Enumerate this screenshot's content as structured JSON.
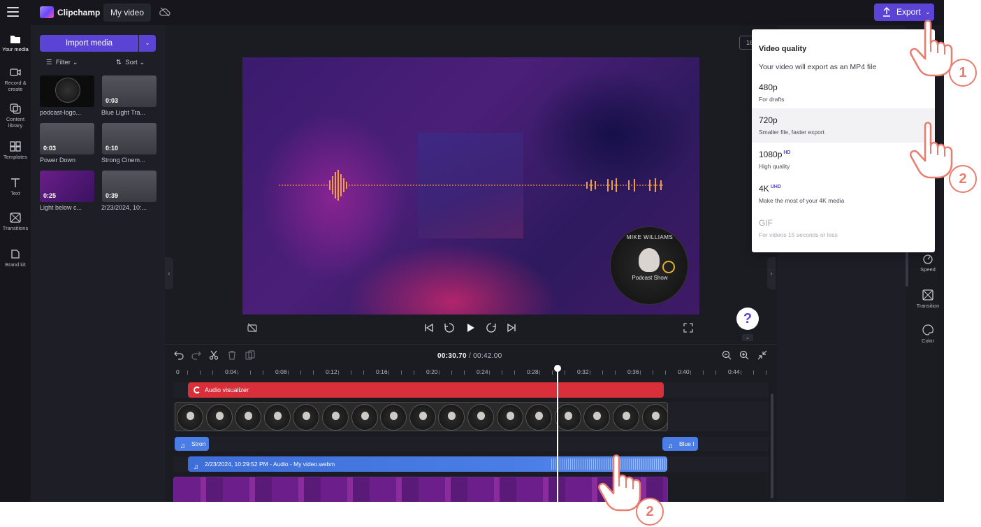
{
  "app": {
    "name": "Clipchamp",
    "project_title": "My video",
    "brand_color": "#5b43d6"
  },
  "toolbar": {
    "export_label": "Export",
    "menu_icon": "hamburger-icon",
    "cloud_icon": "cloud-off-icon"
  },
  "rail": {
    "items": [
      {
        "label": "Your media",
        "icon": "folder-icon"
      },
      {
        "label": "Record & create",
        "icon": "camera-icon"
      },
      {
        "label": "Content library",
        "icon": "library-icon"
      },
      {
        "label": "Templates",
        "icon": "templates-icon"
      },
      {
        "label": "Text",
        "icon": "text-icon"
      },
      {
        "label": "Transitions",
        "icon": "transitions-icon"
      },
      {
        "label": "Brand kit",
        "icon": "brand-kit-icon"
      }
    ]
  },
  "media": {
    "import_label": "Import media",
    "filter_label": "Filter",
    "sort_label": "Sort",
    "items": [
      {
        "caption": "podcast-logo...",
        "duration": ""
      },
      {
        "caption": "Blue Light Tra...",
        "duration": "0:03"
      },
      {
        "caption": "Power Down",
        "duration": "0:03"
      },
      {
        "caption": "Strong Cinem...",
        "duration": "0:10"
      },
      {
        "caption": "Light below c...",
        "duration": "0:25"
      },
      {
        "caption": "2/23/2024, 10:...",
        "duration": "0:39"
      }
    ]
  },
  "preview": {
    "aspect_label": "16",
    "podcast_name": "MIKE WILLIAMS",
    "podcast_show": "Podcast Show",
    "help_label": "?"
  },
  "properties": {
    "items": [
      {
        "label": "Speed",
        "icon": "speed-icon"
      },
      {
        "label": "Transition",
        "icon": "transition-icon"
      },
      {
        "label": "Color",
        "icon": "color-palette-icon"
      }
    ]
  },
  "timeline": {
    "current_time": "00:30.70",
    "total_time": "/ 00:42.00",
    "ticks": [
      "0",
      "0:04",
      "0:08",
      "0:12",
      "0:16",
      "0:20",
      "0:24",
      "0:28",
      "0:32",
      "0:36",
      "0:40",
      "0:44"
    ],
    "clips": {
      "visualizer": "Audio visualizer",
      "music_left": "Stron",
      "music_right": "Blue l",
      "audio": "2/23/2024, 10:29:52 PM - Audio - My video.webm"
    }
  },
  "export_menu": {
    "title": "Video quality",
    "subtitle": "Your video will export as an MP4 file",
    "options": [
      {
        "title": "480p",
        "badge": "",
        "desc": "For drafts"
      },
      {
        "title": "720p",
        "badge": "",
        "desc": "Smaller file, faster export"
      },
      {
        "title": "1080p",
        "badge": "HD",
        "desc": "High quality"
      },
      {
        "title": "4K",
        "badge": "UHD",
        "desc": "Make the most of your 4K media"
      },
      {
        "title": "GIF",
        "badge": "",
        "desc": "For videos 15 seconds or less"
      }
    ]
  },
  "annotations": {
    "step_export": "1",
    "step_720p": "2",
    "step_timeline": "2"
  }
}
